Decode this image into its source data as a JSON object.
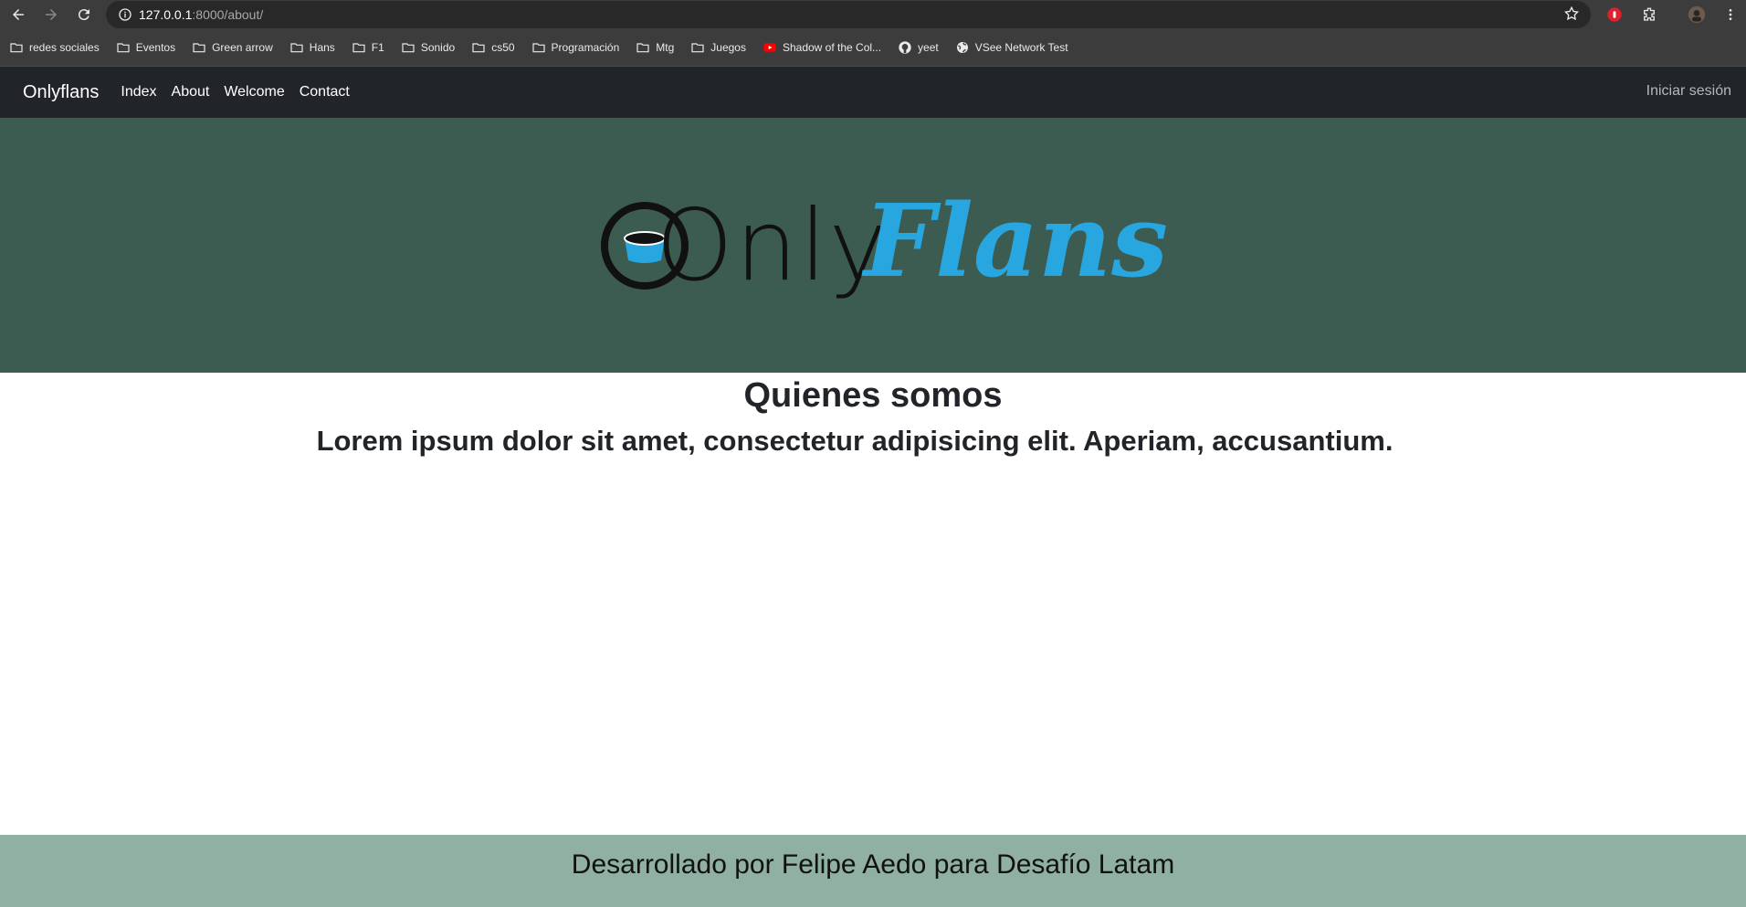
{
  "browser": {
    "url_host": "127.0.0.1",
    "url_path": ":8000/about/",
    "bookmarks": [
      {
        "label": "redes sociales",
        "icon": "folder-icon"
      },
      {
        "label": "Eventos",
        "icon": "folder-icon"
      },
      {
        "label": "Green arrow",
        "icon": "folder-icon"
      },
      {
        "label": "Hans",
        "icon": "folder-icon"
      },
      {
        "label": "F1",
        "icon": "folder-icon"
      },
      {
        "label": "Sonido",
        "icon": "folder-icon"
      },
      {
        "label": "cs50",
        "icon": "folder-icon"
      },
      {
        "label": "Programación",
        "icon": "folder-icon"
      },
      {
        "label": "Mtg",
        "icon": "folder-icon"
      },
      {
        "label": "Juegos",
        "icon": "folder-icon"
      },
      {
        "label": "Shadow of the Col...",
        "icon": "youtube-icon"
      },
      {
        "label": "yeet",
        "icon": "github-icon"
      },
      {
        "label": "VSee Network Test",
        "icon": "globe-icon"
      }
    ]
  },
  "navbar": {
    "brand": "Onlyflans",
    "links": [
      "Index",
      "About",
      "Welcome",
      "Contact"
    ],
    "login": "Iniciar sesión"
  },
  "hero": {
    "logo_only": "Only",
    "logo_flans": "Flans",
    "colors": {
      "background": "#3c5c52",
      "flans": "#27a6df"
    }
  },
  "main": {
    "title": "Quienes somos",
    "subtitle": "Lorem ipsum dolor sit amet, consectetur adipisicing elit. Aperiam, accusantium."
  },
  "footer": {
    "text": "Desarrollado por Felipe Aedo para Desafío Latam",
    "background": "#8fb0a3"
  }
}
